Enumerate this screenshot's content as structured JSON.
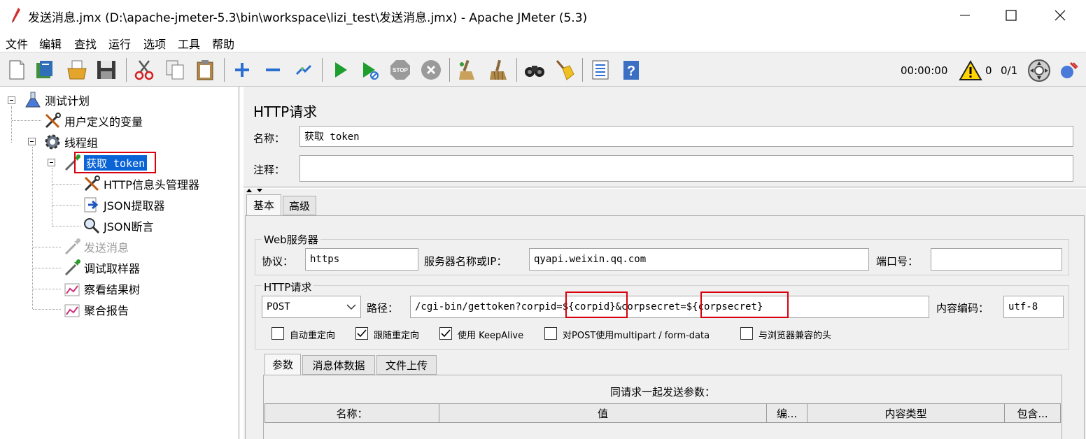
{
  "window": {
    "title": "发送消息.jmx (D:\\apache-jmeter-5.3\\bin\\workspace\\lizi_test\\发送消息.jmx) - Apache JMeter (5.3)"
  },
  "menu": [
    "文件",
    "编辑",
    "查找",
    "运行",
    "选项",
    "工具",
    "帮助"
  ],
  "toolbar": {
    "timer": "00:00:00",
    "warnings": "0",
    "threads": "0/1",
    "icons": [
      "new-icon",
      "templates-icon",
      "open-icon",
      "save-icon",
      "cut-icon",
      "copy-icon",
      "paste-icon",
      "expand-icon",
      "collapse-icon",
      "toggle-icon",
      "start-icon",
      "start-no-pause-icon",
      "stop-icon",
      "shutdown-icon",
      "clear-icon",
      "clear-all-icon",
      "search-icon",
      "reset-search-icon",
      "function-helper-icon",
      "help-icon",
      "warning-icon",
      "remote-icon",
      "log-icon"
    ]
  },
  "tree": {
    "items": [
      {
        "label": "测试计划",
        "icon": "flask-icon"
      },
      {
        "label": "用户定义的变量",
        "icon": "tools-icon"
      },
      {
        "label": "线程组",
        "icon": "gear-icon"
      },
      {
        "label": "获取 token",
        "icon": "pipette-icon"
      },
      {
        "label": "HTTP信息头管理器",
        "icon": "tools-icon"
      },
      {
        "label": "JSON提取器",
        "icon": "extract-icon"
      },
      {
        "label": "JSON断言",
        "icon": "magnifier-icon"
      },
      {
        "label": "发送消息",
        "icon": "pipette-icon"
      },
      {
        "label": "调试取样器",
        "icon": "pipette-icon"
      },
      {
        "label": "察看结果树",
        "icon": "chart-icon"
      },
      {
        "label": "聚合报告",
        "icon": "chart-icon"
      }
    ]
  },
  "panel": {
    "title": "HTTP请求",
    "name_label": "名称：",
    "name_value": "获取 token",
    "comment_label": "注释：",
    "comment_value": "",
    "tabs": [
      "基本",
      "高级"
    ],
    "web_server": {
      "group_label": "Web服务器",
      "protocol_label": "协议：",
      "protocol_value": "https",
      "server_label": "服务器名称或IP：",
      "server_value": "qyapi.weixin.qq.com",
      "port_label": "端口号：",
      "port_value": ""
    },
    "http_request": {
      "group_label": "HTTP请求",
      "method": "POST",
      "path_label": "路径：",
      "path_value": "/cgi-bin/gettoken?corpid=${corpid}&corpsecret=${corpsecret}",
      "encoding_label": "内容编码：",
      "encoding_value": "utf-8"
    },
    "options": [
      {
        "label": "自动重定向",
        "checked": false
      },
      {
        "label": "跟随重定向",
        "checked": true
      },
      {
        "label": "使用 KeepAlive",
        "checked": true
      },
      {
        "label": "对POST使用multipart / form-data",
        "checked": false
      },
      {
        "label": "与浏览器兼容的头",
        "checked": false
      }
    ],
    "sub_tabs": [
      "参数",
      "消息体数据",
      "文件上传"
    ],
    "params_caption": "同请求一起发送参数：",
    "table_headers": [
      "名称：",
      "值",
      "编...",
      "内容类型",
      "包含..."
    ]
  }
}
